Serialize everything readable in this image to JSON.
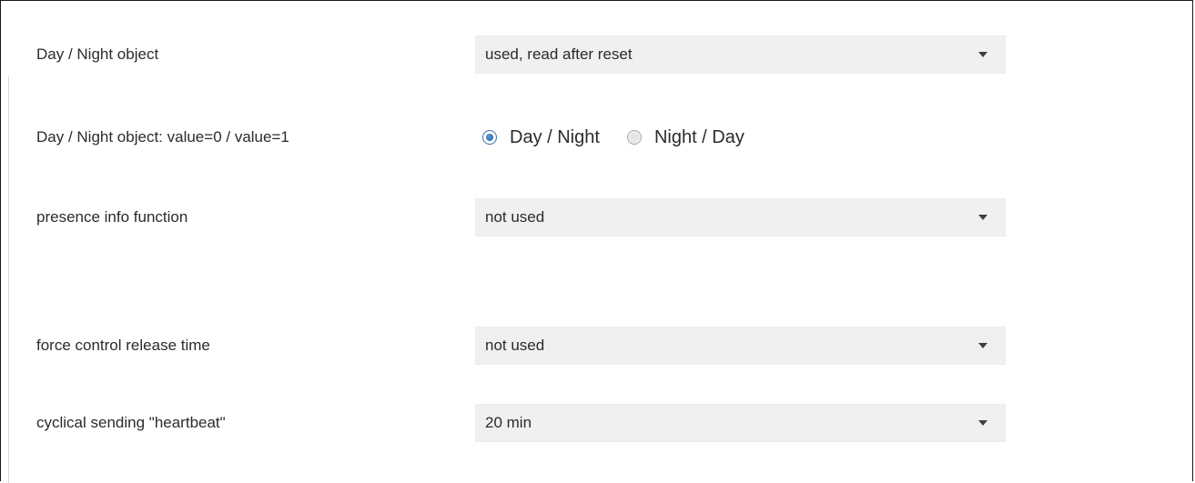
{
  "settings": {
    "day_night_object": {
      "label": "Day / Night object",
      "value": "used, read after reset"
    },
    "day_night_values": {
      "label": "Day / Night object: value=0 / value=1",
      "options": [
        {
          "label": "Day / Night",
          "selected": true
        },
        {
          "label": "Night / Day",
          "selected": false
        }
      ]
    },
    "presence_info": {
      "label": "presence info function",
      "value": "not used"
    },
    "force_control": {
      "label": "force control release time",
      "value": "not used"
    },
    "heartbeat": {
      "label": "cyclical sending \"heartbeat\"",
      "value": "20 min"
    }
  },
  "icons": {
    "dropdown": "chevron-down-icon"
  },
  "colors": {
    "dropdown_bg": "#f0f0f0",
    "radio_selected": "#1f5c9e",
    "text": "#2b2b2b"
  }
}
